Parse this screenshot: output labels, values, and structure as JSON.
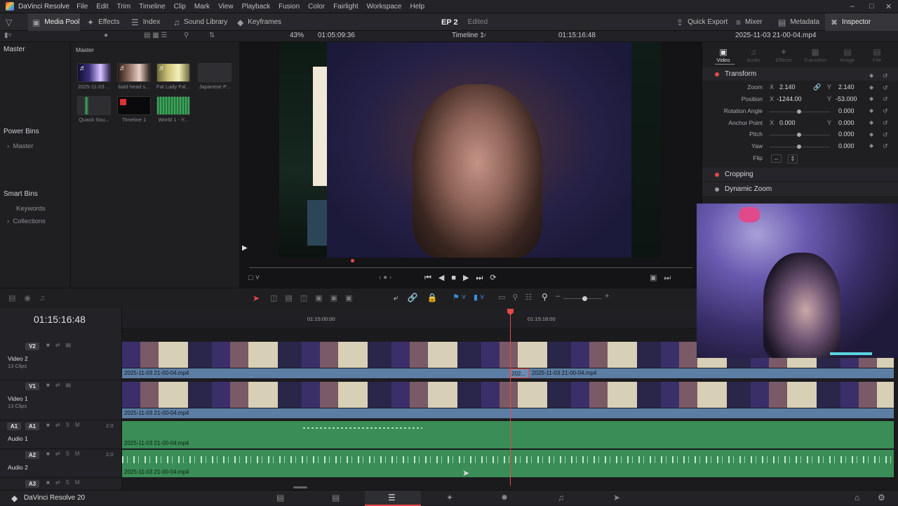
{
  "app": {
    "name": "DaVinci Resolve"
  },
  "menu": [
    "File",
    "Edit",
    "Trim",
    "Timeline",
    "Clip",
    "Mark",
    "View",
    "Playback",
    "Fusion",
    "Color",
    "Fairlight",
    "Workspace",
    "Help"
  ],
  "toolbar": {
    "media_pool": "Media Pool",
    "effects": "Effects",
    "index": "Index",
    "sound_library": "Sound Library",
    "keyframes": "Keyframes",
    "project_title": "EP 2",
    "edited": "Edited",
    "quick_export": "Quick Export",
    "mixer": "Mixer",
    "metadata": "Metadata",
    "inspector": "Inspector"
  },
  "viewer_bar": {
    "zoom": "43%",
    "source_timecode": "01:05:09:36",
    "timeline_name": "Timeline 1",
    "record_timecode": "01:15:16:48",
    "clip_name": "2025-11-03 21-00-04.mp4"
  },
  "left_panel": {
    "master": "Master",
    "power_bins": "Power Bins",
    "power_master": "Master",
    "smart_bins": "Smart Bins",
    "keywords": "Keywords",
    "collections": "Collections"
  },
  "media_pool": {
    "header": "Master",
    "items": [
      {
        "label": "2025-11-03 ..."
      },
      {
        "label": "bald head s..."
      },
      {
        "label": "Fat Lady Fal..."
      },
      {
        "label": "Japanese P..."
      },
      {
        "label": "Quack Sou..."
      },
      {
        "label": "Timeline 1"
      },
      {
        "label": "World 1 - Y..."
      }
    ]
  },
  "inspector": {
    "tabs": [
      "Video",
      "Audio",
      "Effects",
      "Transition",
      "Image",
      "File"
    ],
    "transform": "Transform",
    "zoom_label": "Zoom",
    "zoom_x": "2.140",
    "zoom_y": "2.140",
    "position_label": "Position",
    "position_x": "-1244.00",
    "position_y": "-53.000",
    "rotation_label": "Rotation Angle",
    "rotation": "0.000",
    "anchor_label": "Anchor Point",
    "anchor_x": "0.000",
    "anchor_y": "0.000",
    "pitch_label": "Pitch",
    "pitch": "0.000",
    "yaw_label": "Yaw",
    "yaw": "0.000",
    "flip_label": "Flip",
    "cropping": "Cropping",
    "dynamic_zoom": "Dynamic Zoom",
    "x": "X",
    "y": "Y"
  },
  "timeline": {
    "timecode": "01:15:16:48",
    "ruler": [
      "01:15:00:00",
      "01:15:18:00"
    ],
    "tracks": {
      "v2": {
        "tag": "V2",
        "name": "Video 2",
        "count": "13 Clips",
        "clip": "2025-11-03 21-00-04.mp4",
        "clip2": "202...",
        "clip3": "2025-11-03 21-00-04.mp4"
      },
      "v1": {
        "tag": "V1",
        "name": "Video 1",
        "count": "13 Clips",
        "clip": "2025-11-03 21-00-04.mp4"
      },
      "a1": {
        "tag": "A1",
        "name": "Audio 1",
        "level": "2.0",
        "clip": "2025-11-03 21-00-04.mp4"
      },
      "a2": {
        "tag": "A2",
        "name": "Audio 2",
        "level": "2.0",
        "clip": "2025-11-03 21-00-04.mp4"
      },
      "a3": {
        "tag": "A3"
      }
    }
  },
  "status": {
    "app_version": "DaVinci Resolve 20"
  },
  "colors": {
    "accent": "#e84848",
    "video_clip": "#5d7ea4",
    "audio_clip": "#3a8d56"
  }
}
